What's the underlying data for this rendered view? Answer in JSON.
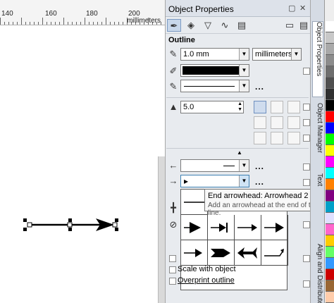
{
  "ruler": {
    "numbers": [
      "140",
      "160",
      "180",
      "200"
    ],
    "unit": "millimeters"
  },
  "docker": {
    "title": "Object Properties",
    "section_title": "Outline",
    "width": {
      "value": "1.0 mm"
    },
    "units": {
      "value": "millimeters"
    },
    "miter": {
      "value": "5.0"
    },
    "more_dots": "...",
    "tooltip": {
      "title": "End arrowhead:  Arrowhead 2",
      "description": "Add an arrowhead at the end of the line."
    },
    "checkboxes": [
      {
        "label": "Scale with object",
        "checked": false
      },
      {
        "label": "Overprint outline",
        "checked": false
      }
    ]
  },
  "tabs": [
    "Object Properties",
    "Object Manager",
    "Text",
    "Align and Distribute"
  ],
  "palette_colors": [
    "#ffffff",
    "#c8c8c8",
    "#a9a9a9",
    "#8c8c8c",
    "#6e6e6e",
    "#4f4f4f",
    "#303030",
    "#000000",
    "#ff0000",
    "#0000ff",
    "#00ff00",
    "#ffff00",
    "#ff00ff",
    "#00ffff",
    "#ff8000",
    "#800080",
    "#00a0c8",
    "#e0e0ff",
    "#ff66cc",
    "#ffcc00",
    "#66ff66",
    "#3399ff",
    "#cc0000",
    "#996633",
    "#ffccaa"
  ]
}
